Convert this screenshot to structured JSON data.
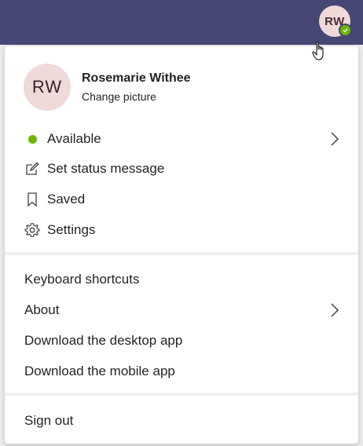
{
  "header": {
    "avatar_initials": "RW",
    "presence_color": "#6bb700",
    "bar_color": "#464775"
  },
  "profile": {
    "initials": "RW",
    "name": "Rosemarie Withee",
    "change_picture": "Change picture"
  },
  "status_section": {
    "items": [
      {
        "label": "Available",
        "icon": "green-dot-icon",
        "has_chevron": true
      },
      {
        "label": "Set status message",
        "icon": "edit-icon"
      },
      {
        "label": "Saved",
        "icon": "bookmark-icon"
      },
      {
        "label": "Settings",
        "icon": "gear-icon"
      }
    ]
  },
  "links_section": {
    "items": [
      {
        "label": "Keyboard shortcuts"
      },
      {
        "label": "About",
        "has_chevron": true
      },
      {
        "label": "Download the desktop app"
      },
      {
        "label": "Download the mobile app"
      }
    ]
  },
  "footer": {
    "sign_out": "Sign out"
  }
}
